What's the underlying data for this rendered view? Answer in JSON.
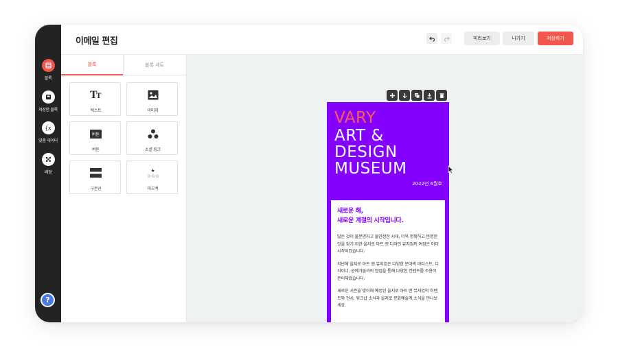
{
  "header": {
    "title": "이메일 편집",
    "undo_icon": "undo-icon",
    "redo_icon": "redo-icon",
    "preview_label": "미리보기",
    "exit_label": "나가기",
    "save_label": "저장하기",
    "save_color": "#f1574d"
  },
  "rail": {
    "items": [
      {
        "label": "블록",
        "icon": "blocks-icon",
        "active": true
      },
      {
        "label": "저장한 블록",
        "icon": "saved-blocks-icon",
        "active": false
      },
      {
        "label": "맞춤 데이터",
        "icon": "custom-data-icon",
        "active": false
      },
      {
        "label": "배경",
        "icon": "background-icon",
        "active": false
      }
    ],
    "help_label": "?"
  },
  "panel": {
    "tabs": [
      {
        "label": "블록",
        "active": true
      },
      {
        "label": "블록 세트",
        "active": false
      }
    ],
    "tiles": [
      {
        "label": "텍스트",
        "icon": "text-icon"
      },
      {
        "label": "이미지",
        "icon": "image-icon"
      },
      {
        "label": "버튼",
        "icon": "button-icon",
        "icon_text": "버튼"
      },
      {
        "label": "소셜 링크",
        "icon": "social-link-icon"
      },
      {
        "label": "구분선",
        "icon": "divider-icon"
      },
      {
        "label": "피드백",
        "icon": "feedback-icon"
      }
    ]
  },
  "canvas": {
    "toolbar": [
      "add-icon",
      "move-down-icon",
      "duplicate-icon",
      "download-icon",
      "delete-icon"
    ],
    "email": {
      "hero": {
        "line1": "VARY",
        "line2": "ART &",
        "line3": "DESIGN",
        "line4": "MUSEUM",
        "date": "2022년 6월호",
        "bg_color": "#8400ff",
        "accent_color": "#ff5a5a"
      },
      "body": {
        "heading1": "새로운 해,",
        "heading2": "새로운 계절의 시작입니다.",
        "p1": "많은 것이 불분명하고 불안정한 시대, 더욱 명확하고 분명한 것을 찾기 위한 을지로 아트 앤 디자인 뮤지엄의 여정은 이미 시작되었습니다.",
        "p2": "지난해 을지로 아트 앤 뮤지엄은 다양한 분야의 아티스트, 디자이너, 공예가들과의 협업을 통해 다양한 컨텐츠를 조용히 준비해왔습니다.",
        "p3": "새로운 시즌을 맞이해 예정된 을지로 아트 앤 뮤지엄의 이벤트와 전시, 워크샵 소식과 을지로 문화예술계 소식을 만나보세요."
      }
    }
  }
}
